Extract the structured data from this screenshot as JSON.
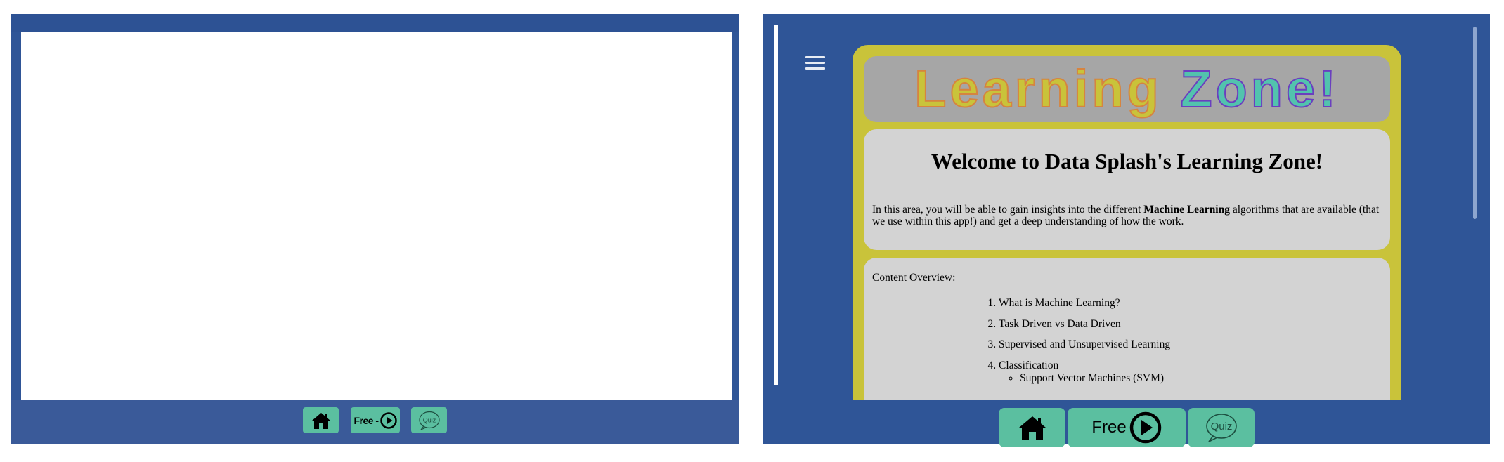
{
  "left_panel": {
    "nav": {
      "home_icon": "home-icon",
      "free_label": "Free -",
      "quiz_label": "Quiz"
    }
  },
  "right_panel": {
    "menu_icon": "hamburger-menu-icon",
    "banner": {
      "word1": "Learning",
      "word2": "Zone!"
    },
    "welcome": {
      "heading": "Welcome to Data Splash's Learning Zone!",
      "text_before": "In this area, you will be able to gain insights into the different ",
      "text_bold": "Machine Learning",
      "text_after": " algorithms that are available (that we use within this app!) and get a deep understanding of how the work."
    },
    "content": {
      "label": "Content Overview:",
      "items": [
        "What is Machine Learning?",
        "Task Driven vs Data Driven",
        "Supervised and Unsupervised Learning",
        "Classification"
      ],
      "sub_items": [
        "Support Vector Machines (SVM)"
      ]
    },
    "nav": {
      "home_icon": "home-icon",
      "free_label": "Free",
      "quiz_label": "Quiz"
    }
  },
  "colors": {
    "panel_blue": "#2f5597",
    "frame_yellow": "#c9c33a",
    "button_teal": "#5bbfa0",
    "card_gray": "#d3d3d3",
    "banner_gray": "#a6a6a6"
  }
}
